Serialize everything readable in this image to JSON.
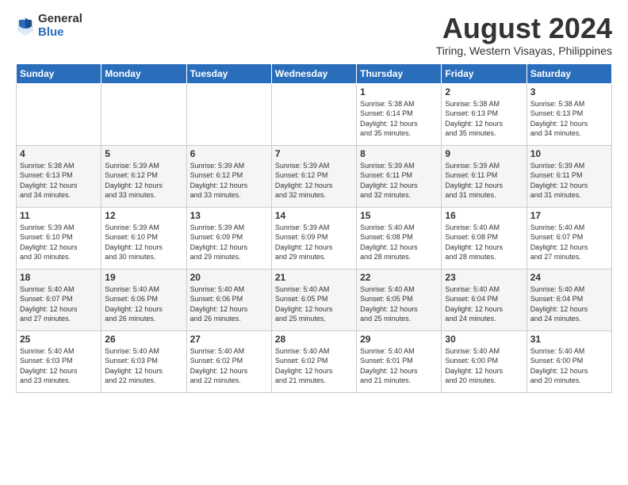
{
  "logo": {
    "general": "General",
    "blue": "Blue"
  },
  "title": "August 2024",
  "subtitle": "Tiring, Western Visayas, Philippines",
  "days_of_week": [
    "Sunday",
    "Monday",
    "Tuesday",
    "Wednesday",
    "Thursday",
    "Friday",
    "Saturday"
  ],
  "weeks": [
    [
      {
        "day": "",
        "detail": ""
      },
      {
        "day": "",
        "detail": ""
      },
      {
        "day": "",
        "detail": ""
      },
      {
        "day": "",
        "detail": ""
      },
      {
        "day": "1",
        "detail": "Sunrise: 5:38 AM\nSunset: 6:14 PM\nDaylight: 12 hours\nand 35 minutes."
      },
      {
        "day": "2",
        "detail": "Sunrise: 5:38 AM\nSunset: 6:13 PM\nDaylight: 12 hours\nand 35 minutes."
      },
      {
        "day": "3",
        "detail": "Sunrise: 5:38 AM\nSunset: 6:13 PM\nDaylight: 12 hours\nand 34 minutes."
      }
    ],
    [
      {
        "day": "4",
        "detail": "Sunrise: 5:38 AM\nSunset: 6:13 PM\nDaylight: 12 hours\nand 34 minutes."
      },
      {
        "day": "5",
        "detail": "Sunrise: 5:39 AM\nSunset: 6:12 PM\nDaylight: 12 hours\nand 33 minutes."
      },
      {
        "day": "6",
        "detail": "Sunrise: 5:39 AM\nSunset: 6:12 PM\nDaylight: 12 hours\nand 33 minutes."
      },
      {
        "day": "7",
        "detail": "Sunrise: 5:39 AM\nSunset: 6:12 PM\nDaylight: 12 hours\nand 32 minutes."
      },
      {
        "day": "8",
        "detail": "Sunrise: 5:39 AM\nSunset: 6:11 PM\nDaylight: 12 hours\nand 32 minutes."
      },
      {
        "day": "9",
        "detail": "Sunrise: 5:39 AM\nSunset: 6:11 PM\nDaylight: 12 hours\nand 31 minutes."
      },
      {
        "day": "10",
        "detail": "Sunrise: 5:39 AM\nSunset: 6:11 PM\nDaylight: 12 hours\nand 31 minutes."
      }
    ],
    [
      {
        "day": "11",
        "detail": "Sunrise: 5:39 AM\nSunset: 6:10 PM\nDaylight: 12 hours\nand 30 minutes."
      },
      {
        "day": "12",
        "detail": "Sunrise: 5:39 AM\nSunset: 6:10 PM\nDaylight: 12 hours\nand 30 minutes."
      },
      {
        "day": "13",
        "detail": "Sunrise: 5:39 AM\nSunset: 6:09 PM\nDaylight: 12 hours\nand 29 minutes."
      },
      {
        "day": "14",
        "detail": "Sunrise: 5:39 AM\nSunset: 6:09 PM\nDaylight: 12 hours\nand 29 minutes."
      },
      {
        "day": "15",
        "detail": "Sunrise: 5:40 AM\nSunset: 6:08 PM\nDaylight: 12 hours\nand 28 minutes."
      },
      {
        "day": "16",
        "detail": "Sunrise: 5:40 AM\nSunset: 6:08 PM\nDaylight: 12 hours\nand 28 minutes."
      },
      {
        "day": "17",
        "detail": "Sunrise: 5:40 AM\nSunset: 6:07 PM\nDaylight: 12 hours\nand 27 minutes."
      }
    ],
    [
      {
        "day": "18",
        "detail": "Sunrise: 5:40 AM\nSunset: 6:07 PM\nDaylight: 12 hours\nand 27 minutes."
      },
      {
        "day": "19",
        "detail": "Sunrise: 5:40 AM\nSunset: 6:06 PM\nDaylight: 12 hours\nand 26 minutes."
      },
      {
        "day": "20",
        "detail": "Sunrise: 5:40 AM\nSunset: 6:06 PM\nDaylight: 12 hours\nand 26 minutes."
      },
      {
        "day": "21",
        "detail": "Sunrise: 5:40 AM\nSunset: 6:05 PM\nDaylight: 12 hours\nand 25 minutes."
      },
      {
        "day": "22",
        "detail": "Sunrise: 5:40 AM\nSunset: 6:05 PM\nDaylight: 12 hours\nand 25 minutes."
      },
      {
        "day": "23",
        "detail": "Sunrise: 5:40 AM\nSunset: 6:04 PM\nDaylight: 12 hours\nand 24 minutes."
      },
      {
        "day": "24",
        "detail": "Sunrise: 5:40 AM\nSunset: 6:04 PM\nDaylight: 12 hours\nand 24 minutes."
      }
    ],
    [
      {
        "day": "25",
        "detail": "Sunrise: 5:40 AM\nSunset: 6:03 PM\nDaylight: 12 hours\nand 23 minutes."
      },
      {
        "day": "26",
        "detail": "Sunrise: 5:40 AM\nSunset: 6:03 PM\nDaylight: 12 hours\nand 22 minutes."
      },
      {
        "day": "27",
        "detail": "Sunrise: 5:40 AM\nSunset: 6:02 PM\nDaylight: 12 hours\nand 22 minutes."
      },
      {
        "day": "28",
        "detail": "Sunrise: 5:40 AM\nSunset: 6:02 PM\nDaylight: 12 hours\nand 21 minutes."
      },
      {
        "day": "29",
        "detail": "Sunrise: 5:40 AM\nSunset: 6:01 PM\nDaylight: 12 hours\nand 21 minutes."
      },
      {
        "day": "30",
        "detail": "Sunrise: 5:40 AM\nSunset: 6:00 PM\nDaylight: 12 hours\nand 20 minutes."
      },
      {
        "day": "31",
        "detail": "Sunrise: 5:40 AM\nSunset: 6:00 PM\nDaylight: 12 hours\nand 20 minutes."
      }
    ]
  ]
}
